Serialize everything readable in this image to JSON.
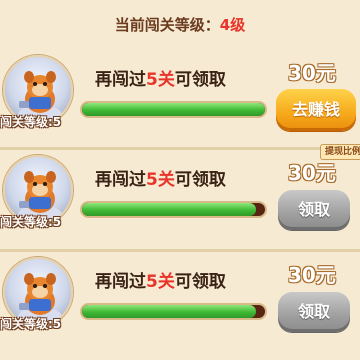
{
  "header": {
    "prefix": "当前闯关等级：",
    "level": "4级"
  },
  "cards": [
    {
      "level_label": "闯关等级:5",
      "task_prefix": "再闯过",
      "task_count": "5关",
      "task_suffix": "可领取",
      "progress": 1.0,
      "reward": "30元",
      "button": "去赚钱",
      "button_state": "active",
      "badge": ""
    },
    {
      "level_label": "闯关等级:5",
      "task_prefix": "再闯过",
      "task_count": "5关",
      "task_suffix": "可领取",
      "progress": 0.95,
      "reward": "30元",
      "button": "领取",
      "button_state": "disabled",
      "badge": "提现比例"
    },
    {
      "level_label": "闯关等级:5",
      "task_prefix": "再闯过",
      "task_count": "5关",
      "task_suffix": "可领取",
      "progress": 0.95,
      "reward": "30元",
      "button": "领取",
      "button_state": "disabled",
      "badge": ""
    }
  ],
  "colors": {
    "background": "#f6ead2",
    "highlight": "#e8342a",
    "progress_fill": "#3fb935",
    "earn_button": "#f6a81a",
    "claim_button": "#9f9f9f"
  },
  "icons": {
    "avatar": "hamster-character-icon"
  }
}
